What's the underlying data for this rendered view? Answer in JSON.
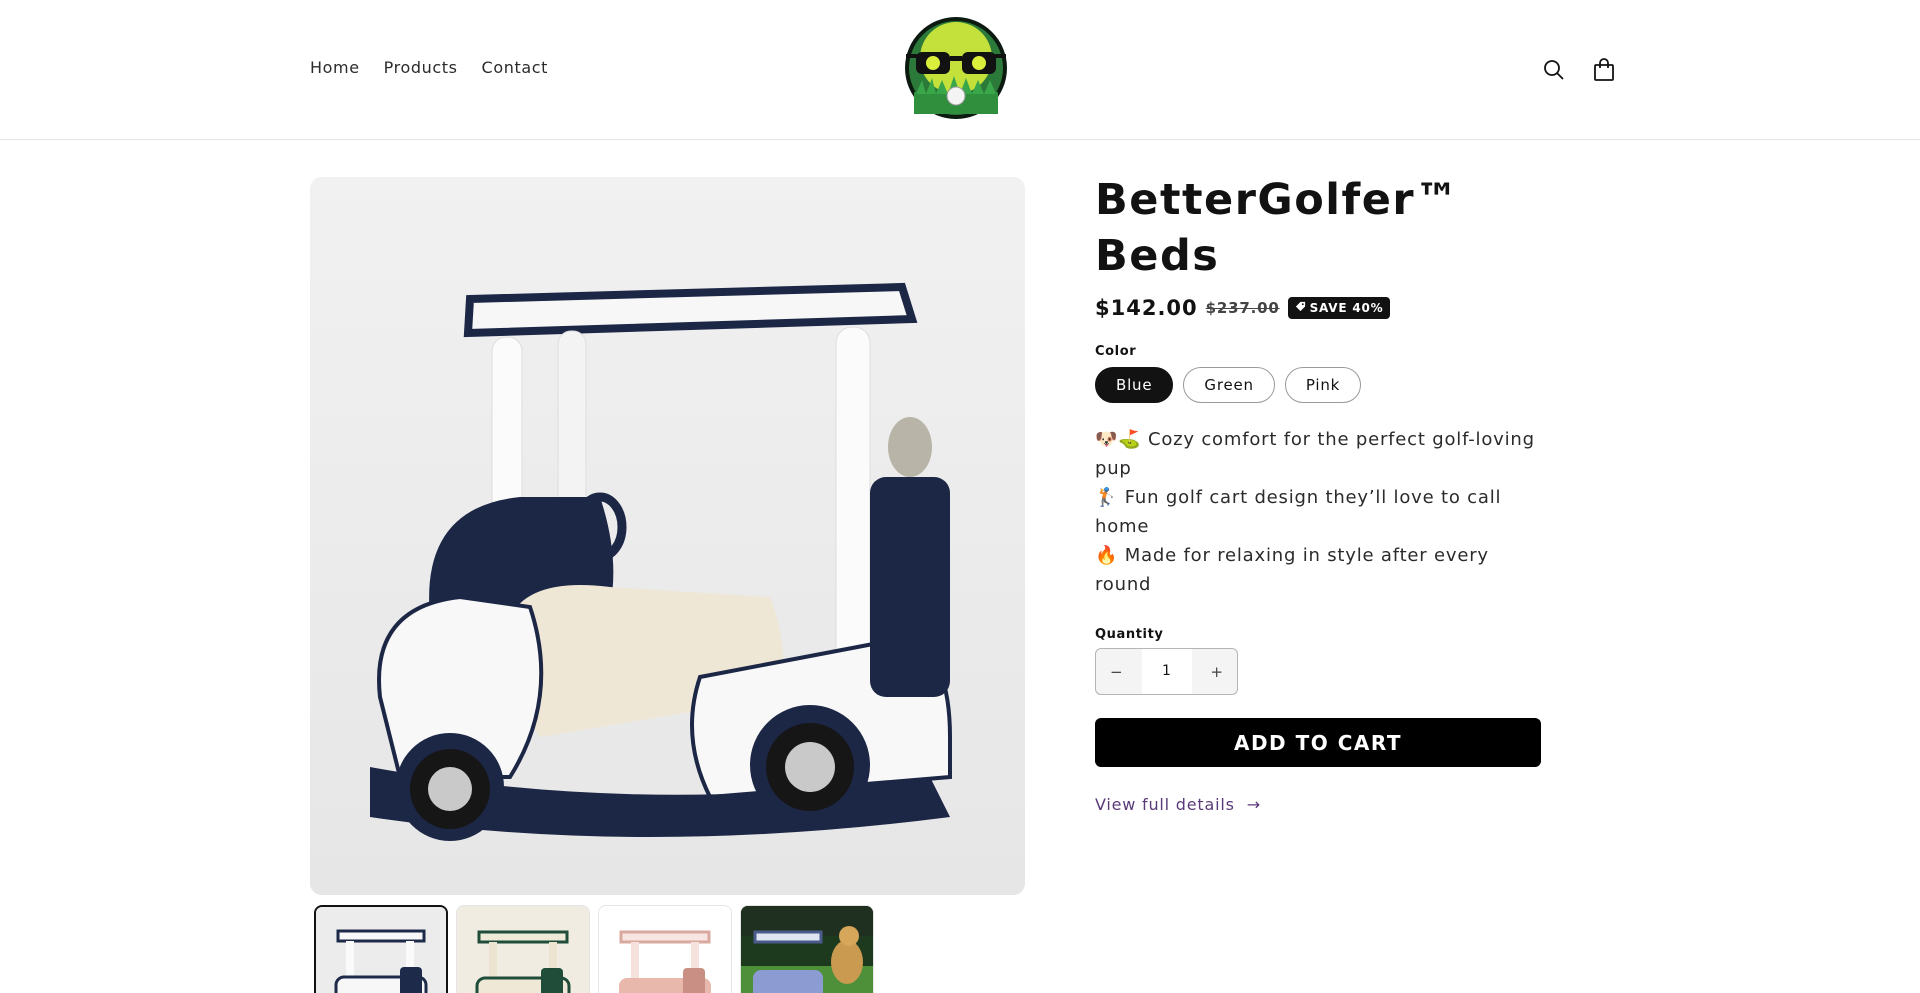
{
  "header": {
    "nav": [
      "Home",
      "Products",
      "Contact"
    ],
    "icons": [
      "search-icon",
      "cart-icon"
    ]
  },
  "product": {
    "title": "BetterGolfer™ Beds",
    "price": "$142.00",
    "compare_price": "$237.00",
    "badge": "SAVE 40%",
    "color_label": "Color",
    "colors": [
      "Blue",
      "Green",
      "Pink"
    ],
    "selected_color": "Blue",
    "features": [
      "🐶⛳ Cozy comfort for the perfect golf-loving pup",
      "🏌 Fun golf cart design they’ll love to call home",
      "🔥 Made for relaxing in style after every round"
    ],
    "quantity_label": "Quantity",
    "quantity": "1",
    "quantity_decrease": "−",
    "quantity_increase": "+",
    "add_to_cart": "ADD TO CART",
    "view_details": "View full details",
    "view_details_arrow": "→"
  },
  "gallery": {
    "thumbnail_colors": [
      "#1e2a4a",
      "#1f4d3a",
      "#d9a9a0",
      "#4a5a8a"
    ]
  }
}
